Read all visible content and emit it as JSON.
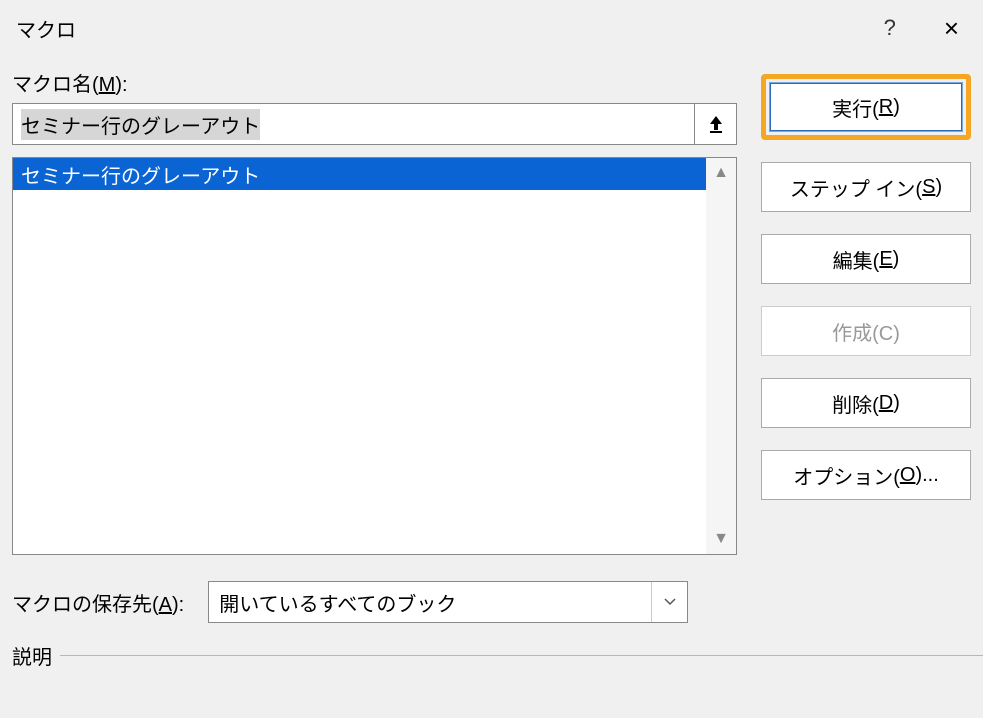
{
  "title": "マクロ",
  "help_char": "?",
  "close_char": "×",
  "labels": {
    "macro_name_pre": "マクロ名(",
    "macro_name_accel": "M",
    "macro_name_post": "):",
    "save_dest_pre": "マクロの保存先(",
    "save_dest_accel": "A",
    "save_dest_post": "):",
    "description": "説明"
  },
  "macro_name_value": "セミナー行のグレーアウト",
  "list_items": [
    "セミナー行のグレーアウト"
  ],
  "save_dest_value": "開いているすべてのブック",
  "buttons": {
    "run_pre": "実行(",
    "run_accel": "R",
    "run_post": ")",
    "step_pre": "ステップ イン(",
    "step_accel": "S",
    "step_post": ")",
    "edit_pre": "編集(",
    "edit_accel": "E",
    "edit_post": ")",
    "create": "作成(C)",
    "delete_pre": "削除(",
    "delete_accel": "D",
    "delete_post": ")",
    "options_pre": "オプション(",
    "options_accel": "O",
    "options_post": ")..."
  }
}
